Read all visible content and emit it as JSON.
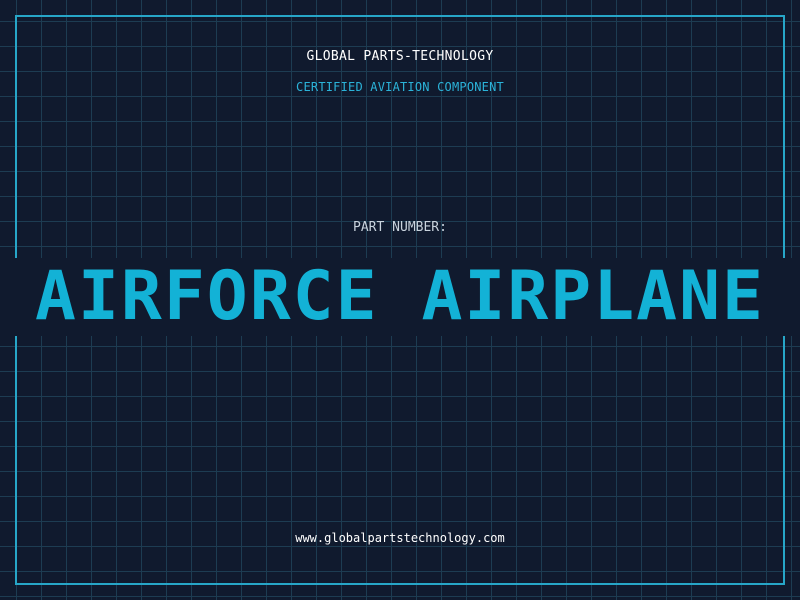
{
  "header": {
    "company_name": "GLOBAL PARTS-TECHNOLOGY",
    "tagline": "CERTIFIED AVIATION COMPONENT"
  },
  "part": {
    "label": "PART NUMBER:",
    "value": "AIRFORCE AIRPLANE"
  },
  "footer": {
    "website": "www.globalpartstechnology.com"
  },
  "colors": {
    "background": "#101a2e",
    "grid": "#1d3c52",
    "accent": "#13b2d6",
    "border": "#27a6c8"
  }
}
